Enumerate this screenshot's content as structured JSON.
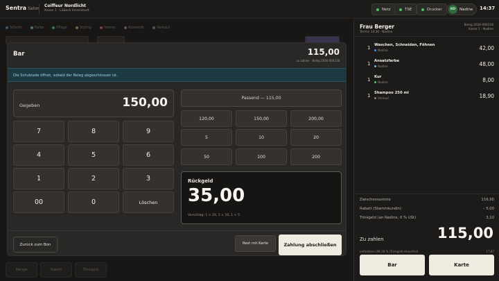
{
  "app": {
    "name": "Sentra",
    "suffix": "Salon"
  },
  "salon": {
    "name": "Coiffeur Nordlicht",
    "location": "Kasse 1 · Lübeck Innenstadt"
  },
  "status": {
    "net": "Netz",
    "tse": "TSE",
    "printer": "Drucker",
    "user_initials": "ND",
    "user": "Nadine",
    "time": "14:37",
    "ok_color": "#4bc06a"
  },
  "background": {
    "categories": [
      {
        "label": "Schnitt",
        "color": "#4a90d9"
      },
      {
        "label": "Farbe",
        "color": "#7fb5d6"
      },
      {
        "label": "Pflege",
        "color": "#5fbf7a"
      },
      {
        "label": "Styling",
        "color": "#c9a646"
      },
      {
        "label": "Herren",
        "color": "#d06a5a"
      },
      {
        "label": "Kosmetik",
        "color": "#b86ec9"
      },
      {
        "label": "Verkauf",
        "color": "#8b8682"
      }
    ],
    "bottom_buttons": {
      "qty": "Menge",
      "discount": "Rabatt",
      "tip": "Trinkgeld"
    }
  },
  "modal": {
    "title": "Bar",
    "amount": "115,00",
    "amount_sub": "zu zahlen · Beleg 2026-000318",
    "notice": "Die Schublade öffnet, sobald der Beleg abgeschlossen ist.",
    "given_label": "Gegeben",
    "given_value": "150,00",
    "keys": [
      "7",
      "8",
      "9",
      "4",
      "5",
      "6",
      "1",
      "2",
      "3",
      "00",
      "0",
      "Löschen"
    ],
    "exact": "Passend — 115,00",
    "quick": [
      "120,00",
      "150,00",
      "200,00",
      "5",
      "10",
      "20",
      "50",
      "100",
      "200"
    ],
    "change_label": "Rückgeld",
    "change_value": "35,00",
    "change_hint": "Vorschlag: 1 × 20, 1 × 10, 1 × 5",
    "back": "Zurück zum Bon",
    "rest_card": "Rest mit Karte",
    "finish": "Zahlung abschließen"
  },
  "panel": {
    "customer": "Frau Berger",
    "customer_sub": "Termin 14:30 · Nadine",
    "receipt_no": "Beleg 2026-000318",
    "register": "Kasse 1 · Nadine",
    "items": [
      {
        "qty": "1",
        "name": "Waschen, Schneiden, Föhnen",
        "staff": "Nadine",
        "dot": "#4a90d9",
        "price": "42,00"
      },
      {
        "qty": "1",
        "name": "Ansatzfarbe",
        "staff": "Nadine",
        "dot": "#7fb5d6",
        "price": "48,00"
      },
      {
        "qty": "1",
        "name": "Kur",
        "staff": "Nadine",
        "dot": "#5fbf7a",
        "price": "8,00"
      },
      {
        "qty": "1",
        "name": "Shampoo 250 ml",
        "staff": "Verkauf",
        "dot": "#8b8682",
        "price": "18,90"
      }
    ],
    "subtotal_label": "Zwischensumme",
    "subtotal": "116,90",
    "discount_label": "Rabatt (Stammkundin)",
    "discount": "– 5,00",
    "tip_label": "Trinkgeld (an Nadine, 0 % USt)",
    "tip": "3,10",
    "due_label": "Zu zahlen",
    "due": "115,00",
    "tax_label": "enthaltene USt 19 % (Trinkgeld steuerfrei)",
    "tax": "17,87",
    "pay_cash": "Bar",
    "pay_card": "Karte"
  }
}
